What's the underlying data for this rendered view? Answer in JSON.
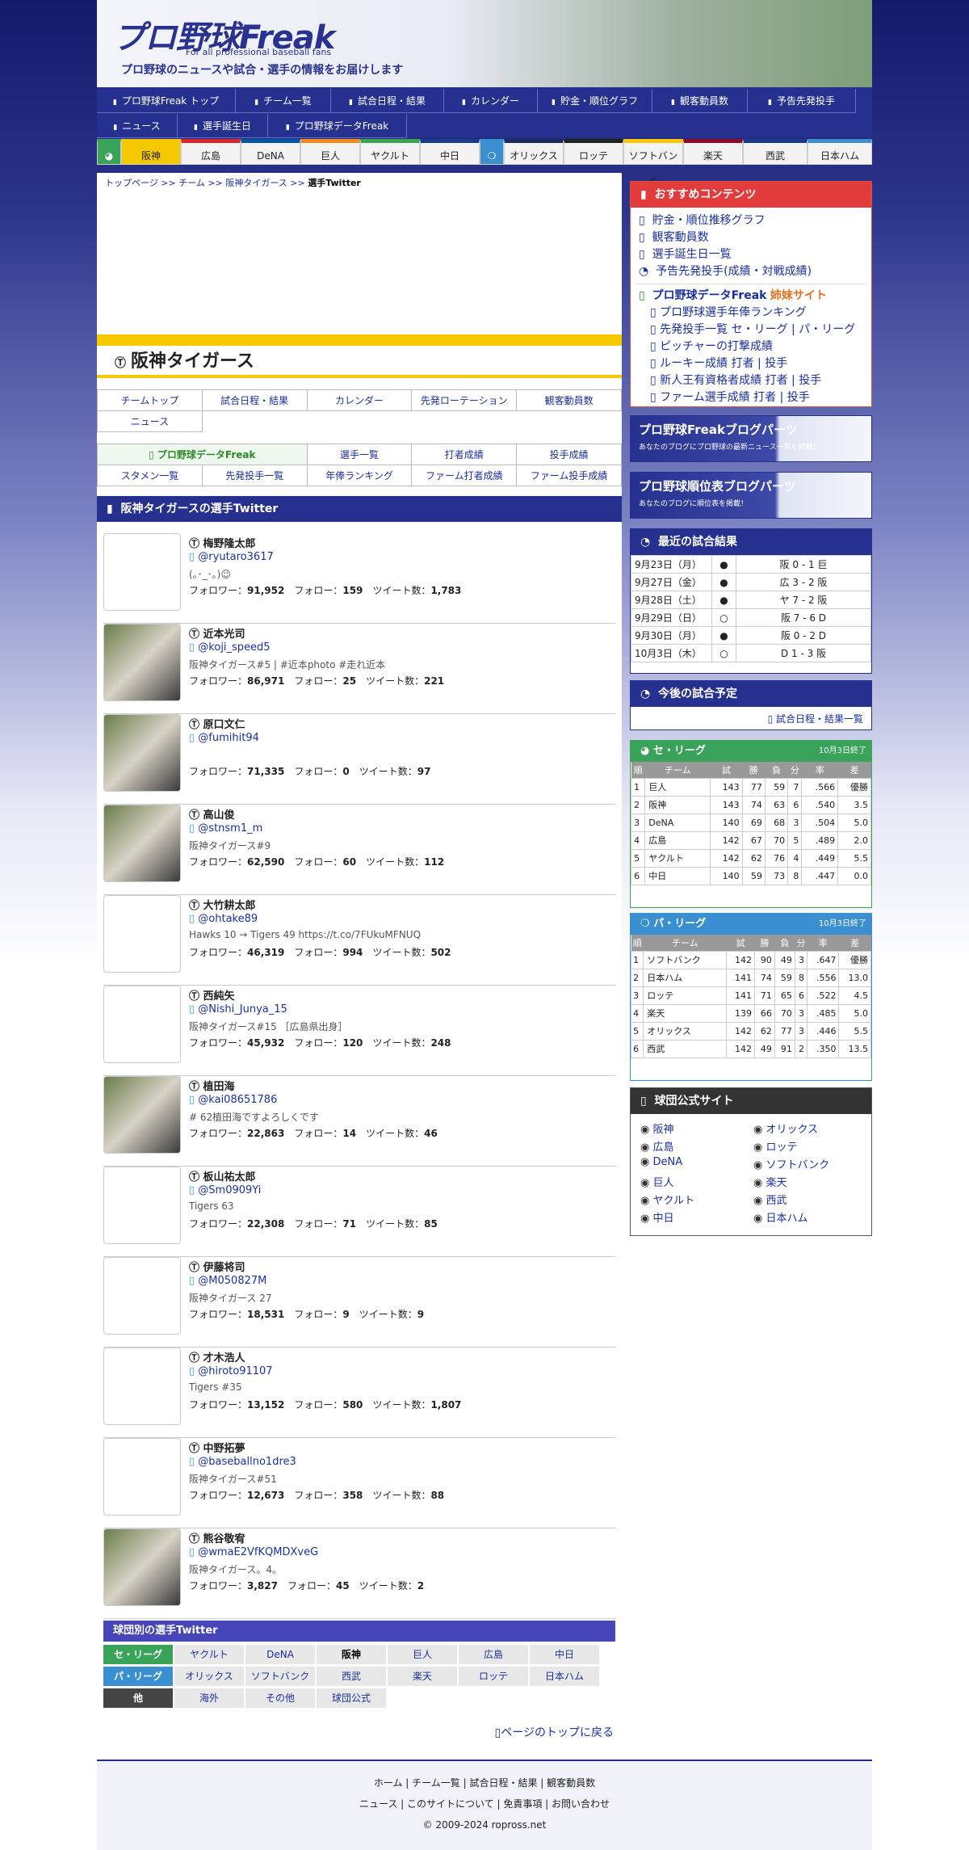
{
  "header": {
    "logo": "プロ野球Freak",
    "logo_sub": "For all professional baseball fans",
    "tagline": "プロ野球のニュースや試合・選手の情報をお届けします"
  },
  "gnav": {
    "items": [
      "プロ野球Freak トップ",
      "チーム一覧",
      "試合日程・結果",
      "カレンダー",
      "貯金・順位グラフ",
      "観客動員数",
      "予告先発投手",
      "ニュース",
      "選手誕生日",
      "プロ野球データFreak"
    ]
  },
  "teamnav": {
    "items": [
      "阪神",
      "広島",
      "DeNA",
      "巨人",
      "ヤクルト",
      "中日",
      "オリックス",
      "ロッテ",
      "ソフトバンク",
      "楽天",
      "西武",
      "日本ハム"
    ]
  },
  "breadcrumb": {
    "home": "トップページ",
    "teams": "チーム",
    "team": "阪神タイガース",
    "current": "選手Twitter"
  },
  "team_title": "阪神タイガース",
  "team_menu": {
    "row1": [
      "チームトップ",
      "試合日程・結果",
      "カレンダー",
      "先発ローテーション",
      "観客動員数"
    ],
    "row2": [
      "ニュース"
    ],
    "row3": [
      "プロ野球データFreak",
      "選手一覧",
      "打者成績",
      "投手成績"
    ],
    "row4": [
      "スタメン一覧",
      "先発投手一覧",
      "年俸ランキング",
      "ファーム打者成績",
      "ファーム投手成績"
    ]
  },
  "section_title": "阪神タイガースの選手Twitter",
  "stat_labels": {
    "followers": "フォロワー：",
    "following": "フォロー：",
    "tweets": "ツイート数："
  },
  "players": [
    {
      "name": "梅野隆太郎",
      "handle": "@ryutaro3617",
      "desc": "(｡･_･｡)☺",
      "followers": "91,952",
      "following": "159",
      "tweets": "1,783"
    },
    {
      "name": "近本光司",
      "handle": "@koji_speed5",
      "desc": "阪神タイガース#5 | #近本photo #走れ近本",
      "followers": "86,971",
      "following": "25",
      "tweets": "221"
    },
    {
      "name": "原口文仁",
      "handle": "@fumihit94",
      "desc": "",
      "followers": "71,335",
      "following": "0",
      "tweets": "97"
    },
    {
      "name": "高山俊",
      "handle": "@stnsm1_m",
      "desc": "阪神タイガース#9",
      "followers": "62,590",
      "following": "60",
      "tweets": "112"
    },
    {
      "name": "大竹耕太郎",
      "handle": "@ohtake89",
      "desc": "Hawks 10 → Tigers 49 https://t.co/7FUkuMFNUQ",
      "followers": "46,319",
      "following": "994",
      "tweets": "502"
    },
    {
      "name": "西純矢",
      "handle": "@Nishi_Junya_15",
      "desc": "阪神タイガース#15 ［広島県出身］",
      "followers": "45,932",
      "following": "120",
      "tweets": "248"
    },
    {
      "name": "植田海",
      "handle": "@kai08651786",
      "desc": "# 62植田海ですよろしくです",
      "followers": "22,863",
      "following": "14",
      "tweets": "46"
    },
    {
      "name": "板山祐太郎",
      "handle": "@Sm0909Yi",
      "desc": "Tigers 63",
      "followers": "22,308",
      "following": "71",
      "tweets": "85"
    },
    {
      "name": "伊藤将司",
      "handle": "@M050827M",
      "desc": "阪神タイガース 27",
      "followers": "18,531",
      "following": "9",
      "tweets": "9"
    },
    {
      "name": "才木浩人",
      "handle": "@hiroto91107",
      "desc": "Tigers #35",
      "followers": "13,152",
      "following": "580",
      "tweets": "1,807"
    },
    {
      "name": "中野拓夢",
      "handle": "@baseballno1dre3",
      "desc": "阪神タイガース#51",
      "followers": "12,673",
      "following": "358",
      "tweets": "88"
    },
    {
      "name": "熊谷敬宥",
      "handle": "@wmaE2VfKQMDXveG",
      "desc": "阪神タイガース。4。",
      "followers": "3,827",
      "following": "45",
      "tweets": "2"
    }
  ],
  "club_section": {
    "title": "球団別の選手Twitter",
    "central_label": "セ・リーグ",
    "central": [
      "ヤクルト",
      "DeNA",
      "阪神",
      "巨人",
      "広島",
      "中日"
    ],
    "pacific_label": "パ・リーグ",
    "pacific": [
      "オリックス",
      "ソフトバンク",
      "西武",
      "楽天",
      "ロッテ",
      "日本ハム"
    ],
    "other_label": "他",
    "other": [
      "海外",
      "その他",
      "球団公式"
    ]
  },
  "totop": "ページのトップに戻る",
  "side": {
    "recommend_title": "おすすめコンテンツ",
    "recommend": [
      "貯金・順位推移グラフ",
      "観客動員数",
      "選手誕生日一覧",
      "予告先発投手(成績・対戦成績)"
    ],
    "sister_title": "プロ野球データFreak",
    "sister_suffix": "姉妹サイト",
    "sister": [
      "プロ野球選手年俸ランキング",
      "先発投手一覧 セ・リーグ | パ・リーグ",
      "ピッチャーの打撃成績",
      "ルーキー成績 打者 | 投手",
      "新人王有資格者成績 打者 | 投手",
      "ファーム選手成績 打者 | 投手"
    ],
    "banner1": {
      "title": "プロ野球Freakブログパーツ",
      "sub": "あなたのブログにプロ野球の最新ニュース一覧を掲載！"
    },
    "banner2": {
      "title": "プロ野球順位表ブログパーツ",
      "sub": "あなたのブログに順位表を掲載！"
    },
    "results_title": "最近の試合結果",
    "results": [
      {
        "date": "9月23日（月）",
        "mark": "●",
        "score": "阪 0 - 1 巨"
      },
      {
        "date": "9月27日（金）",
        "mark": "●",
        "score": "広 3 - 2 阪"
      },
      {
        "date": "9月28日（土）",
        "mark": "●",
        "score": "ヤ 7 - 2 阪"
      },
      {
        "date": "9月29日（日）",
        "mark": "○",
        "score": "阪 7 - 6 D"
      },
      {
        "date": "9月30日（月）",
        "mark": "●",
        "score": "阪 0 - 2 D"
      },
      {
        "date": "10月3日（木）",
        "mark": "○",
        "score": "D 1 - 3 阪"
      }
    ],
    "upcoming_title": "今後の試合予定",
    "upcoming_link": "試合日程・結果一覧",
    "central_title": "セ・リーグ",
    "central_note": "10月3日終了",
    "pacific_title": "パ・リーグ",
    "pacific_note": "10月3日終了",
    "stand_headers": [
      "順",
      "チーム",
      "試",
      "勝",
      "負",
      "分",
      "率",
      "差"
    ],
    "central_rows": [
      [
        "1",
        "巨人",
        "143",
        "77",
        "59",
        "7",
        ".566",
        "優勝"
      ],
      [
        "2",
        "阪神",
        "143",
        "74",
        "63",
        "6",
        ".540",
        "3.5"
      ],
      [
        "3",
        "DeNA",
        "140",
        "69",
        "68",
        "3",
        ".504",
        "5.0"
      ],
      [
        "4",
        "広島",
        "142",
        "67",
        "70",
        "5",
        ".489",
        "2.0"
      ],
      [
        "5",
        "ヤクルト",
        "142",
        "62",
        "76",
        "4",
        ".449",
        "5.5"
      ],
      [
        "6",
        "中日",
        "140",
        "59",
        "73",
        "8",
        ".447",
        "0.0"
      ]
    ],
    "pacific_rows": [
      [
        "1",
        "ソフトバンク",
        "142",
        "90",
        "49",
        "3",
        ".647",
        "優勝"
      ],
      [
        "2",
        "日本ハム",
        "141",
        "74",
        "59",
        "8",
        ".556",
        "13.0"
      ],
      [
        "3",
        "ロッテ",
        "141",
        "71",
        "65",
        "6",
        ".522",
        "4.5"
      ],
      [
        "4",
        "楽天",
        "139",
        "66",
        "70",
        "3",
        ".485",
        "5.0"
      ],
      [
        "5",
        "オリックス",
        "142",
        "62",
        "77",
        "3",
        ".446",
        "5.5"
      ],
      [
        "6",
        "西武",
        "142",
        "49",
        "91",
        "2",
        ".350",
        "13.5"
      ]
    ],
    "official_title": "球団公式サイト",
    "official": [
      "阪神",
      "オリックス",
      "広島",
      "ロッテ",
      "DeNA",
      "ソフトバンク",
      "巨人",
      "楽天",
      "ヤクルト",
      "西武",
      "中日",
      "日本ハム"
    ]
  },
  "footer": {
    "row1": "ホーム | チーム一覧 | 試合日程・結果 | 観客動員数",
    "row2": "ニュース | このサイトについて | 免責事項 | お問い合わせ",
    "copy": "© 2009-2024 ropross.net"
  },
  "colors": {
    "navy": "#26318f",
    "yellow": "#f5c800",
    "red": "#e23b3b",
    "central": "#3aa35a",
    "pacific": "#3a8fd0"
  }
}
